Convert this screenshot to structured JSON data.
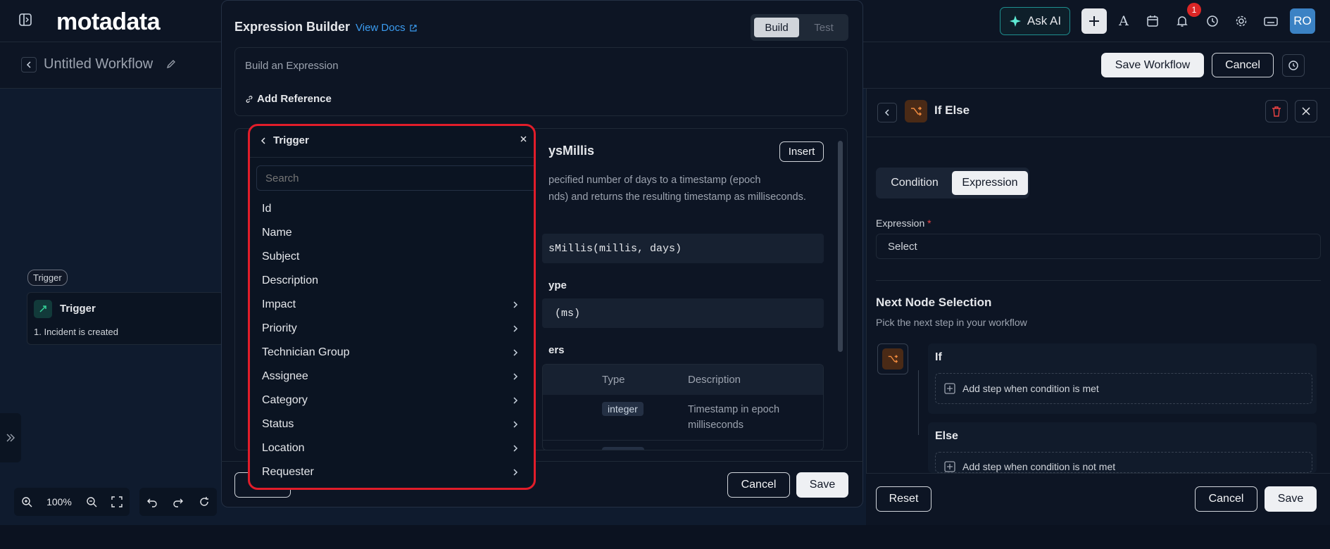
{
  "topbar": {
    "logo": "motadata",
    "ask_ai_label": "Ask AI",
    "notification_count": "1",
    "avatar_initials": "RO"
  },
  "workflow": {
    "title": "Untitled Workflow",
    "save_label": "Save Workflow",
    "cancel_label": "Cancel"
  },
  "canvas": {
    "trigger_pill": "Trigger",
    "trigger_card_title": "Trigger",
    "trigger_card_desc": "1. Incident is created",
    "zoom": "100%"
  },
  "right_panel": {
    "title": "If Else",
    "tab_condition": "Condition",
    "tab_expression": "Expression",
    "expression_label": "Expression",
    "expression_placeholder": "Select",
    "next_node_title": "Next Node Selection",
    "next_node_subtitle": "Pick the next step in your workflow",
    "if_label": "If",
    "if_add": "Add step when condition is met",
    "else_label": "Else",
    "else_add": "Add step when condition is not met",
    "reset_label": "Reset",
    "cancel_label": "Cancel",
    "save_label": "Save"
  },
  "modal": {
    "title": "Expression Builder",
    "view_docs": "View Docs",
    "tab_build": "Build",
    "tab_test": "Test",
    "input_placeholder": "Build an Expression",
    "add_reference": "Add Reference",
    "doc_func_name": "ysMillis",
    "insert_label": "Insert",
    "doc_desc_line1": "pecified number of days to a timestamp (epoch",
    "doc_desc_line2": "nds) and returns the resulting timestamp as milliseconds.",
    "doc_signature": "sMillis(millis, days)",
    "doc_return_heading": "ype",
    "doc_return_value": "(ms)",
    "doc_params_heading": "ers",
    "param_col_type": "Type",
    "param_col_desc": "Description",
    "param_type": "integer",
    "param_desc_line1": "Timestamp in epoch",
    "param_desc_line2": "milliseconds",
    "cancel_label": "Cancel",
    "save_label": "Save"
  },
  "dropdown": {
    "header": "Trigger",
    "search_placeholder": "Search",
    "items": [
      {
        "label": "Id",
        "has_children": false
      },
      {
        "label": "Name",
        "has_children": false
      },
      {
        "label": "Subject",
        "has_children": false
      },
      {
        "label": "Description",
        "has_children": false
      },
      {
        "label": "Impact",
        "has_children": true
      },
      {
        "label": "Priority",
        "has_children": true
      },
      {
        "label": "Technician Group",
        "has_children": true
      },
      {
        "label": "Assignee",
        "has_children": true
      },
      {
        "label": "Category",
        "has_children": true
      },
      {
        "label": "Status",
        "has_children": true
      },
      {
        "label": "Location",
        "has_children": true
      },
      {
        "label": "Requester",
        "has_children": true
      }
    ]
  },
  "colors": {
    "accent_orange": "#f08a3e",
    "highlight_red": "#e11d2a",
    "link_blue": "#3b9cf0",
    "ai_teal": "#1e8f8f"
  }
}
